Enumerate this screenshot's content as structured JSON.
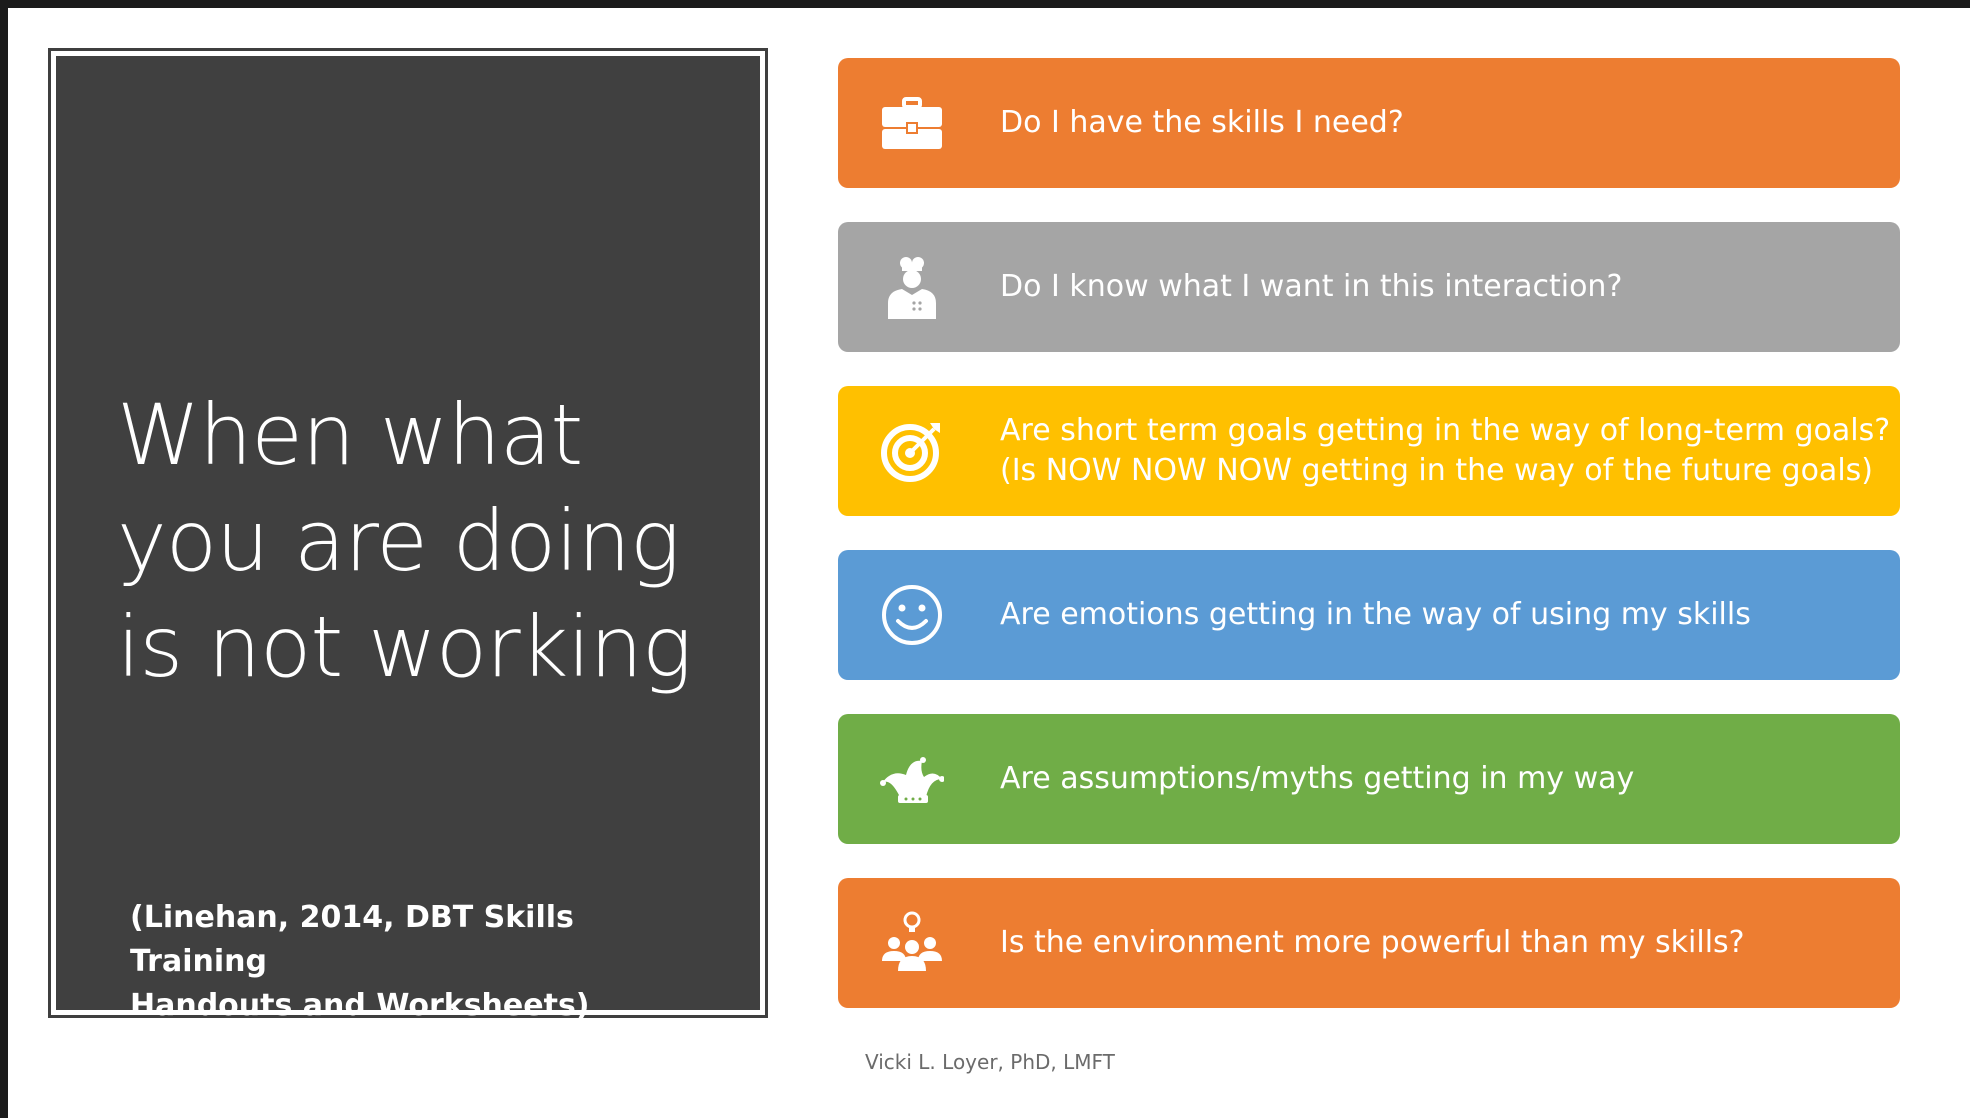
{
  "slide": {
    "title": "When what\nyou are doing\nis not working",
    "citation": "(Linehan, 2014, DBT Skills Training\nHandouts and Worksheets)",
    "footer": "Vicki L. Loyer, PhD, LMFT"
  },
  "items": [
    {
      "label": "Do I have the skills I need?",
      "color": "#ed7d31",
      "icon": "briefcase-icon"
    },
    {
      "label": "Do I know what I want in this interaction?",
      "color": "#a5a5a5",
      "icon": "chef-icon"
    },
    {
      "label": "Are short term goals getting in the way of long-term goals?\n(Is NOW NOW NOW getting in the way of the future goals)",
      "color": "#ffc000",
      "icon": "target-icon"
    },
    {
      "label": "Are emotions getting in the way of using my skills",
      "color": "#5b9bd5",
      "icon": "smiley-icon"
    },
    {
      "label": "Are assumptions/myths getting in my way",
      "color": "#70ad47",
      "icon": "jester-hat-icon"
    },
    {
      "label": "Is the environment more powerful than my skills?",
      "color": "#ed7d31",
      "icon": "group-idea-icon"
    }
  ]
}
